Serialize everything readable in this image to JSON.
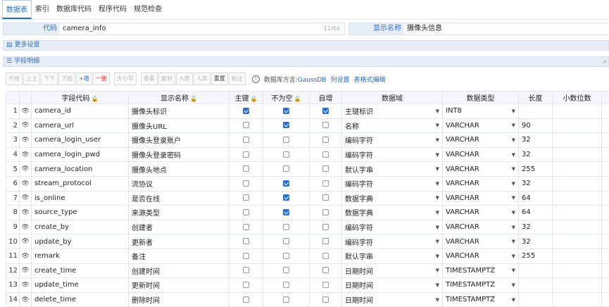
{
  "tabs": [
    {
      "label": "数据表",
      "active": true
    },
    {
      "label": "索引"
    },
    {
      "label": "数据库代码"
    },
    {
      "label": "程序代码"
    },
    {
      "label": "规范检查"
    }
  ],
  "code": {
    "label": "代码",
    "value": "camera_info",
    "counter": "11/64"
  },
  "display_name": {
    "label": "显示名称",
    "value": "摄像头信息"
  },
  "more_settings": "更多设置",
  "field_details": "字段明细",
  "toolbar": {
    "buttons": [
      "不接",
      "上上",
      "下下",
      "下底",
      "+增",
      "一删",
      "大小写",
      "查看",
      "复制",
      "入库",
      "入库",
      "重置",
      "标注"
    ],
    "db_dialect_label": "数据库方言:",
    "db_dialect_value": "GaussDB",
    "col_settings": "列设置",
    "table_format": "表格式编辑"
  },
  "columns": {
    "field_code": "字段代码",
    "display_name": "显示名称",
    "pk": "主键",
    "not_null": "不为空",
    "auto_inc": "自增",
    "domain": "数据域",
    "data_type": "数据类型",
    "length": "长度",
    "decimals": "小数位数"
  },
  "rows": [
    {
      "no": "1",
      "code": "camera_id",
      "name": "摄像头标识",
      "pk": true,
      "nn": true,
      "ai": true,
      "domain": "主键标识",
      "type": "INT8",
      "len": ""
    },
    {
      "no": "2",
      "code": "camera_url",
      "name": "摄像头URL",
      "pk": false,
      "nn": true,
      "ai": false,
      "domain": "名称",
      "type": "VARCHAR",
      "len": "90"
    },
    {
      "no": "3",
      "code": "camera_login_user",
      "name": "摄像头登录账户",
      "pk": false,
      "nn": false,
      "ai": false,
      "domain": "编码字符",
      "type": "VARCHAR",
      "len": "32"
    },
    {
      "no": "4",
      "code": "camera_login_pwd",
      "name": "摄像头登录密码",
      "pk": false,
      "nn": false,
      "ai": false,
      "domain": "编码字符",
      "type": "VARCHAR",
      "len": "32"
    },
    {
      "no": "5",
      "code": "camera_location",
      "name": "摄像头地点",
      "pk": false,
      "nn": false,
      "ai": false,
      "domain": "默认字串",
      "type": "VARCHAR",
      "len": "255"
    },
    {
      "no": "6",
      "code": "stream_protocol",
      "name": "流协议",
      "pk": false,
      "nn": true,
      "ai": false,
      "domain": "编码字符",
      "type": "VARCHAR",
      "len": "32"
    },
    {
      "no": "7",
      "code": "is_online",
      "name": "是否在线",
      "pk": false,
      "nn": true,
      "ai": false,
      "domain": "数据字典",
      "type": "VARCHAR",
      "len": "64"
    },
    {
      "no": "8",
      "code": "source_type",
      "name": "来源类型",
      "pk": false,
      "nn": true,
      "ai": false,
      "domain": "数据字典",
      "type": "VARCHAR",
      "len": "64"
    },
    {
      "no": "9",
      "code": "create_by",
      "name": "创建者",
      "pk": false,
      "nn": false,
      "ai": false,
      "domain": "编码字符",
      "type": "VARCHAR",
      "len": "32"
    },
    {
      "no": "10",
      "code": "update_by",
      "name": "更新者",
      "pk": false,
      "nn": false,
      "ai": false,
      "domain": "编码字符",
      "type": "VARCHAR",
      "len": "32"
    },
    {
      "no": "11",
      "code": "remark",
      "name": "备注",
      "pk": false,
      "nn": false,
      "ai": false,
      "domain": "默认字串",
      "type": "VARCHAR",
      "len": "255"
    },
    {
      "no": "12",
      "code": "create_time",
      "name": "创建时间",
      "pk": false,
      "nn": false,
      "ai": false,
      "domain": "日期时间",
      "type": "TIMESTAMPTZ",
      "len": ""
    },
    {
      "no": "13",
      "code": "update_time",
      "name": "更新时间",
      "pk": false,
      "nn": false,
      "ai": false,
      "domain": "日期时间",
      "type": "TIMESTAMPTZ",
      "len": ""
    },
    {
      "no": "14",
      "code": "delete_time",
      "name": "删除时间",
      "pk": false,
      "nn": false,
      "ai": false,
      "domain": "日期时间",
      "type": "TIMESTAMPTZ",
      "len": ""
    }
  ],
  "icons": {
    "eye": "eye-icon",
    "lock": "lock-icon",
    "info": "info-icon",
    "chevron": "chevron-down-icon",
    "search": "search-icon"
  },
  "colors": {
    "accent": "#1f6fd1",
    "checkbox": "#2a6fd6",
    "bar": "#e6edf7"
  }
}
